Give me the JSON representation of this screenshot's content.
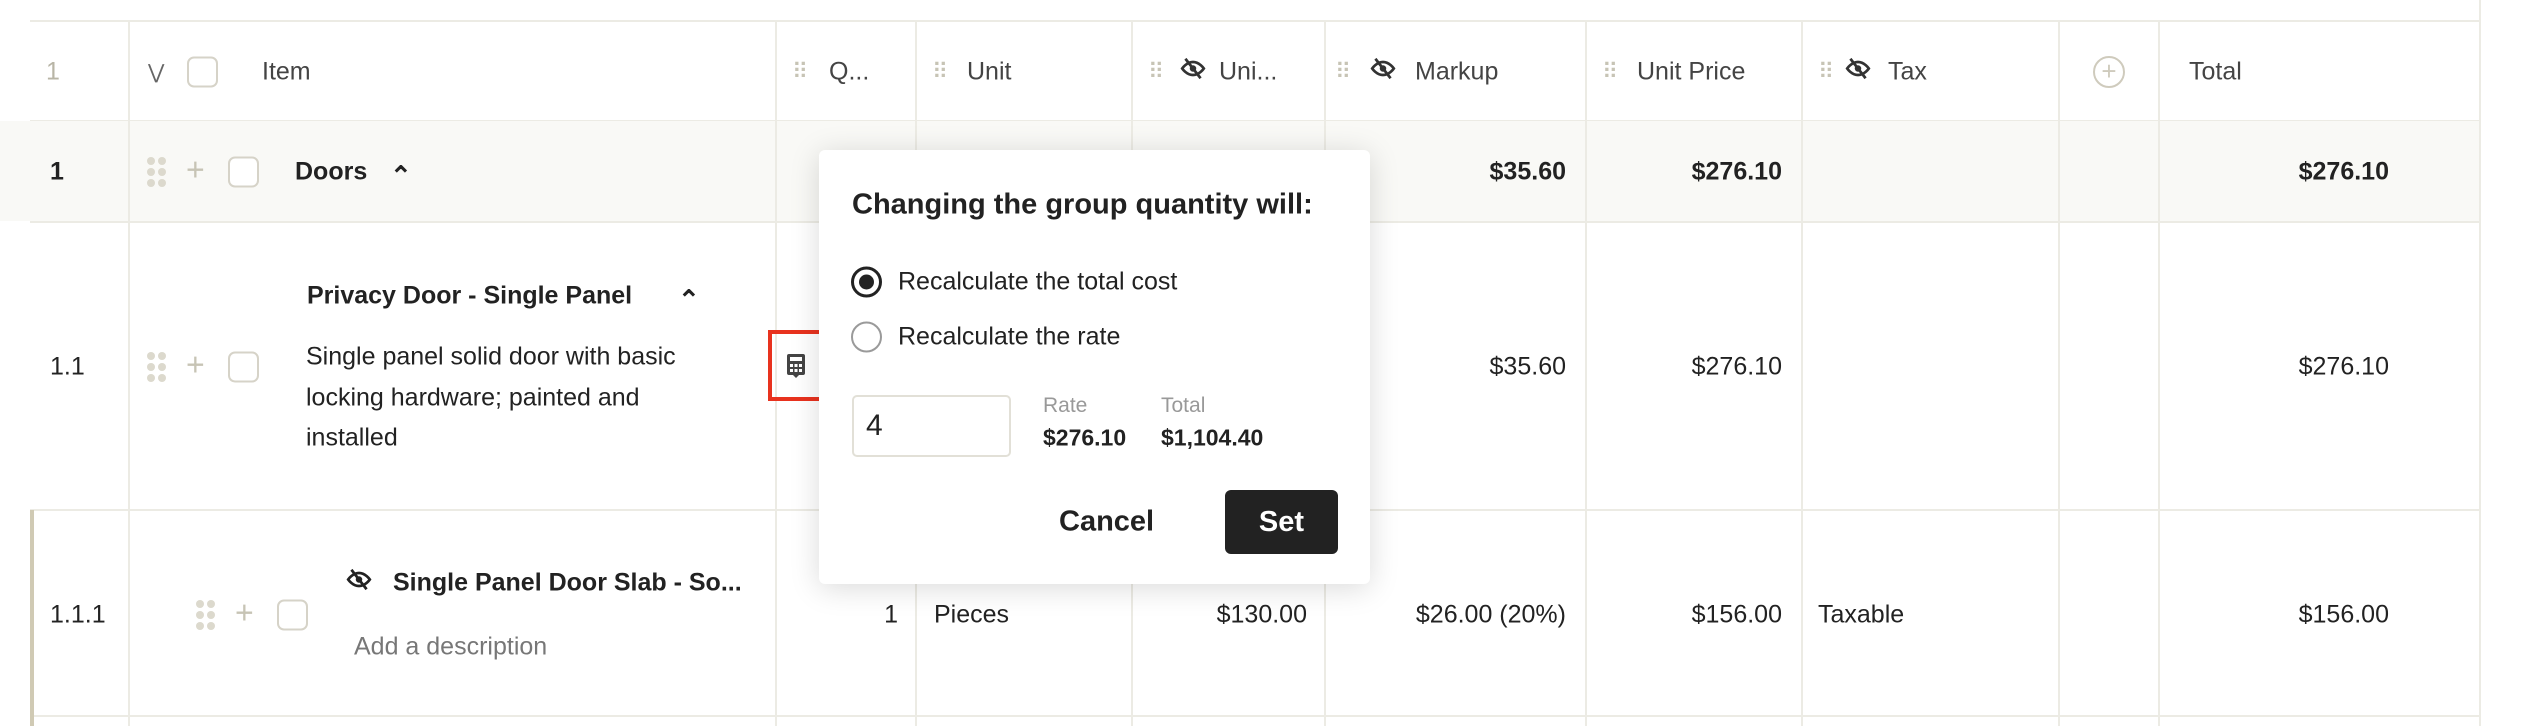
{
  "header": {
    "row_number": "1",
    "item": "Item",
    "quantity": "Q...",
    "unit": "Unit",
    "unit_cost": "Uni...",
    "markup": "Markup",
    "unit_price": "Unit Price",
    "tax": "Tax",
    "total": "Total"
  },
  "rows": [
    {
      "number": "1",
      "title": "Doors",
      "markup": "$35.60",
      "unit_price": "$276.10",
      "total": "$276.10"
    },
    {
      "number": "1.1",
      "title": "Privacy Door - Single Panel",
      "description": [
        "Single panel solid door with basic",
        "locking hardware; painted and",
        "installed"
      ],
      "markup": "$35.60",
      "unit_price": "$276.10",
      "total": "$276.10"
    },
    {
      "number": "1.1.1",
      "title": "Single Panel Door Slab - So...",
      "description": "Add a description",
      "quantity": "1",
      "unit": "Pieces",
      "unit_cost": "$130.00",
      "markup": "$26.00 (20%)",
      "unit_price": "$156.00",
      "tax": "Taxable",
      "total": "$156.00"
    }
  ],
  "popup": {
    "title": "Changing the group quantity will:",
    "options": [
      "Recalculate the total cost",
      "Recalculate the rate"
    ],
    "selected": 0,
    "quantity": "4",
    "rate_label": "Rate",
    "rate_value": "$276.10",
    "total_label": "Total",
    "total_value": "$1,104.40",
    "cancel": "Cancel",
    "set": "Set"
  },
  "colors": {
    "accent_border": "#d0cab4",
    "highlight": "#e8321e",
    "button": "#222222"
  }
}
